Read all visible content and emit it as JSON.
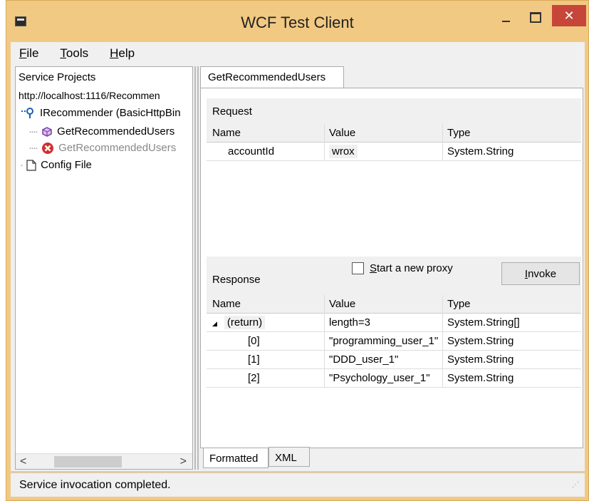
{
  "window": {
    "title": "WCF Test Client",
    "minimize": "",
    "maximize": "",
    "close": "✕"
  },
  "menu": [
    {
      "label": "File",
      "underline": "F",
      "rest": "ile"
    },
    {
      "label": "Tools",
      "underline": "T",
      "rest": "ools"
    },
    {
      "label": "Help",
      "underline": "H",
      "rest": "elp"
    }
  ],
  "tree": {
    "root": "Service Projects",
    "url": "http://localhost:1116/Recommen",
    "interface": "IRecommender (BasicHttpBin",
    "operation": "GetRecommendedUsers",
    "operation_error": "GetRecommendedUsers",
    "config": "Config File"
  },
  "document_tab": "GetRecommendedUsers",
  "request": {
    "title": "Request",
    "columns": [
      "Name",
      "Value",
      "Type"
    ],
    "rows": [
      {
        "name": "accountId",
        "value": "wrox",
        "type": "System.String"
      }
    ]
  },
  "response": {
    "title": "Response",
    "start_new_proxy": "Start a new proxy",
    "invoke": "Invoke",
    "columns": [
      "Name",
      "Value",
      "Type"
    ],
    "rows": [
      {
        "name": "(return)",
        "value": "length=3",
        "type": "System.String[]",
        "expander": "◢"
      },
      {
        "name": "[0]",
        "value": "\"programming_user_1\"",
        "type": "System.String"
      },
      {
        "name": "[1]",
        "value": "\"DDD_user_1\"",
        "type": "System.String"
      },
      {
        "name": "[2]",
        "value": "\"Psychology_user_1\"",
        "type": "System.String"
      }
    ]
  },
  "bottom_tabs": [
    "Formatted",
    "XML"
  ],
  "status": "Service invocation completed.",
  "scroll": {
    "left": "<",
    "right": ">"
  },
  "colors": {
    "titlebar": "#f2c983",
    "close": "#c7463a",
    "panel": "#f0f0f0"
  },
  "icons": {
    "app": "app-icon",
    "interface": "interface-icon",
    "operation": "operation-icon",
    "error": "error-icon",
    "config": "file-icon"
  }
}
